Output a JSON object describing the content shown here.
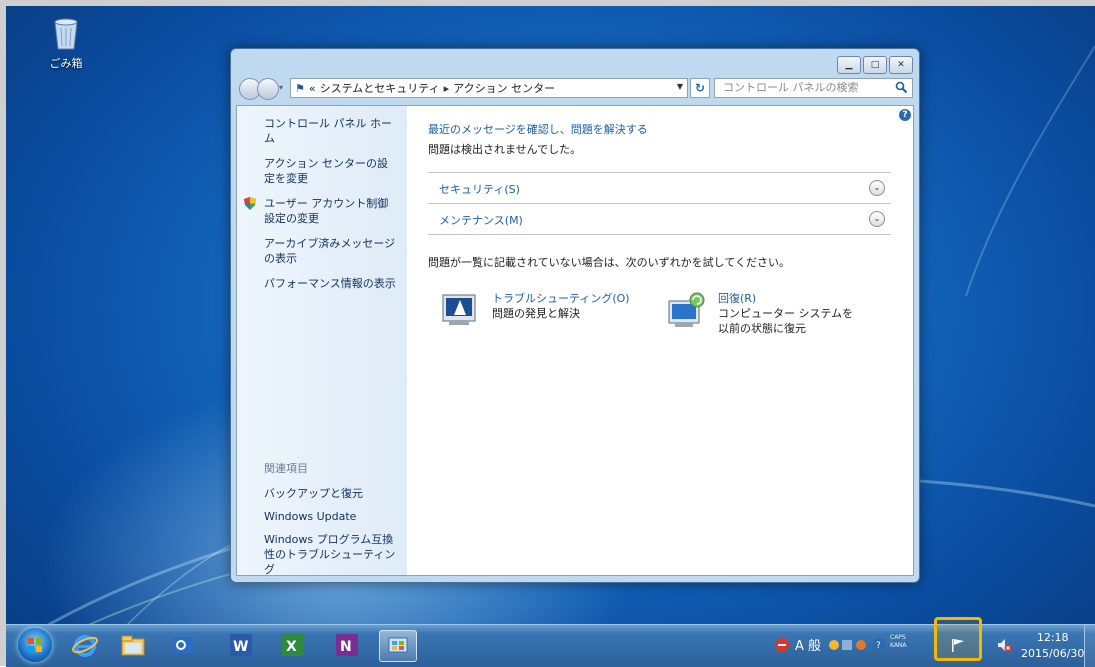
{
  "desktop": {
    "recycle_bin_label": "ごみ箱"
  },
  "window": {
    "address": {
      "prefix": "«",
      "crumbs": [
        "システムとセキュリティ",
        "アクション センター"
      ],
      "separator": "▸"
    },
    "search_placeholder": "コントロール パネルの検索",
    "left_pane": {
      "links": [
        "コントロール パネル ホーム",
        "アクション センターの設定を変更",
        "ユーザー アカウント制御設定の変更",
        "アーカイブ済みメッセージの表示",
        "パフォーマンス情報の表示"
      ],
      "related_heading": "関連項目",
      "related_links": [
        "バックアップと復元",
        "Windows Update",
        "Windows プログラム互換性のトラブルシューティング"
      ]
    },
    "main": {
      "title": "最近のメッセージを確認し、問題を解決する",
      "subtitle": "問題は検出されませんでした。",
      "sections": [
        "セキュリティ(S)",
        "メンテナンス(M)"
      ],
      "hint": "問題が一覧に記載されていない場合は、次のいずれかを試してください。",
      "tasks": [
        {
          "link": "トラブルシューティング(O)",
          "desc": "問題の発見と解決"
        },
        {
          "link": "回復(R)",
          "desc1": "コンピューター システムを",
          "desc2": "以前の状態に復元"
        }
      ]
    }
  },
  "taskbar": {
    "apps": [
      "internet-explorer",
      "file-explorer",
      "outlook",
      "word",
      "excel",
      "onenote",
      "control-panel"
    ],
    "tray": {
      "ime_mode": "A",
      "ime_label": "般",
      "caps_label": "CAPS",
      "kana_label": "KANA"
    },
    "clock": {
      "time": "12:18",
      "date": "2015/06/30"
    }
  }
}
